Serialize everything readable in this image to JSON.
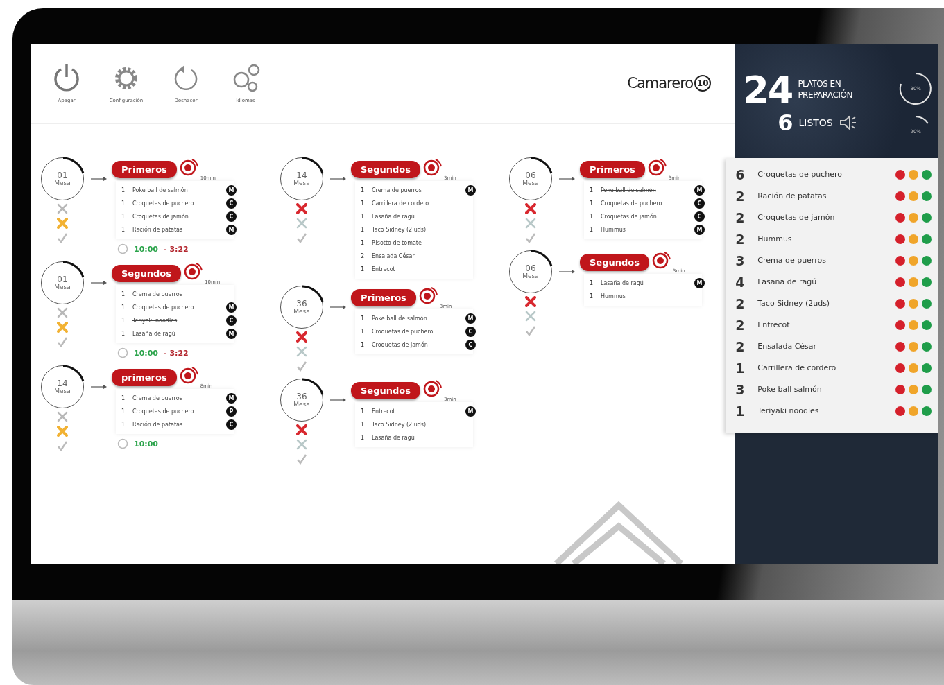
{
  "toolbar": {
    "buttons": [
      {
        "kind": "power",
        "label": "Apagar"
      },
      {
        "kind": "gear",
        "label": "Configuración"
      },
      {
        "kind": "undo",
        "label": "Deshacer"
      },
      {
        "kind": "language",
        "label": "Idiomas"
      }
    ],
    "logo": "Camarero",
    "logo_badge": "10"
  },
  "columns": [
    [
      {
        "table": "01",
        "table_label": "Mesa",
        "cancelled": false,
        "delayed": true,
        "course": "Primeros",
        "eta": "10min",
        "times": {
          "start": "10:00",
          "elapsed": "- 3:22"
        },
        "items": [
          {
            "qty": "1",
            "name": "Poke ball de salmón",
            "badge": "M",
            "done": false
          },
          {
            "qty": "1",
            "name": "Croquetas de puchero",
            "badge": "C",
            "done": false
          },
          {
            "qty": "1",
            "name": "Croquetas de jamón",
            "badge": "C",
            "done": false
          },
          {
            "qty": "1",
            "name": "Ración de patatas",
            "badge": "M",
            "done": false
          }
        ]
      },
      {
        "table": "01",
        "table_label": "Mesa",
        "cancelled": false,
        "delayed": true,
        "course": "Segundos",
        "eta": "10min",
        "times": {
          "start": "10:00",
          "elapsed": "- 3:22"
        },
        "items": [
          {
            "qty": "1",
            "name": "Crema de puerros",
            "done": false
          },
          {
            "qty": "1",
            "name": "Croquetas de puchero",
            "badge": "M",
            "done": false
          },
          {
            "qty": "1",
            "name": "Teriyaki noodles",
            "badge": "C",
            "done": true
          },
          {
            "qty": "1",
            "name": "Lasaña de ragú",
            "badge": "M",
            "done": false
          }
        ]
      },
      {
        "table": "14",
        "table_label": "Mesa",
        "cancelled": false,
        "delayed": true,
        "course": "primeros",
        "eta": "8min",
        "times": {
          "start": "10:00"
        },
        "items": [
          {
            "qty": "1",
            "name": "Crema de puerros",
            "badge": "M",
            "done": false
          },
          {
            "qty": "1",
            "name": "Croquetas de puchero",
            "badge": "P",
            "done": false
          },
          {
            "qty": "1",
            "name": "Ración de patatas",
            "badge": "C",
            "done": false
          }
        ]
      }
    ],
    [
      {
        "table": "14",
        "table_label": "Mesa",
        "cancelled": true,
        "delayed": false,
        "course": "Segundos",
        "eta": "3min",
        "items": [
          {
            "qty": "1",
            "name": "Crema de puerros",
            "badge": "M",
            "done": false
          },
          {
            "qty": "1",
            "name": "Carrillera de cordero",
            "done": false
          },
          {
            "qty": "1",
            "name": "Lasaña de ragú",
            "done": false
          },
          {
            "qty": "1",
            "name": "Taco Sidney (2 uds)",
            "done": false
          },
          {
            "qty": "1",
            "name": "Risotto de tomate",
            "done": false
          },
          {
            "qty": "2",
            "name": "Ensalada César",
            "done": false
          },
          {
            "qty": "1",
            "name": "Entrecot",
            "done": false
          }
        ]
      },
      {
        "table": "36",
        "table_label": "Mesa",
        "cancelled": true,
        "delayed": false,
        "course": "Primeros",
        "eta": "3min",
        "items": [
          {
            "qty": "1",
            "name": "Poke ball de salmón",
            "badge": "M",
            "done": false
          },
          {
            "qty": "1",
            "name": "Croquetas de puchero",
            "badge": "C",
            "done": false
          },
          {
            "qty": "1",
            "name": "Croquetas de jamón",
            "badge": "C",
            "done": false
          }
        ]
      },
      {
        "table": "36",
        "table_label": "Mesa",
        "cancelled": true,
        "delayed": false,
        "course": "Segundos",
        "eta": "3min",
        "items": [
          {
            "qty": "1",
            "name": "Entrecot",
            "badge": "M",
            "done": false
          },
          {
            "qty": "1",
            "name": "Taco Sidney (2 uds)",
            "done": false
          },
          {
            "qty": "1",
            "name": "Lasaña de ragú",
            "done": false
          }
        ]
      }
    ],
    [
      {
        "table": "06",
        "table_label": "Mesa",
        "cancelled": true,
        "delayed": false,
        "course": "Primeros",
        "eta": "3min",
        "items": [
          {
            "qty": "1",
            "name": "Poke ball de salmón",
            "badge": "M",
            "done": true
          },
          {
            "qty": "1",
            "name": "Croquetas de puchero",
            "badge": "C",
            "done": false
          },
          {
            "qty": "1",
            "name": "Croquetas de jamón",
            "badge": "C",
            "done": false
          },
          {
            "qty": "1",
            "name": "Hummus",
            "badge": "M",
            "done": false
          }
        ]
      },
      {
        "table": "06",
        "table_label": "Mesa",
        "cancelled": true,
        "delayed": false,
        "course": "Segundos",
        "eta": "3min",
        "items": [
          {
            "qty": "1",
            "name": "Lasaña de ragú",
            "badge": "M",
            "done": false
          },
          {
            "qty": "1",
            "name": "Hummus",
            "done": false
          }
        ]
      }
    ]
  ],
  "summary": {
    "in_progress": "24",
    "in_progress_label": "PLATOS EN PREPARACIÓN",
    "ready": "6",
    "ready_label": "LISTOS",
    "gauges": [
      {
        "reading": "80%"
      },
      {
        "reading": "20%"
      }
    ],
    "dishes": [
      {
        "qty": "6",
        "name": "Croquetas de puchero"
      },
      {
        "qty": "2",
        "name": "Ración de patatas"
      },
      {
        "qty": "2",
        "name": "Croquetas de jamón"
      },
      {
        "qty": "2",
        "name": "Hummus"
      },
      {
        "qty": "3",
        "name": "Crema de puerros"
      },
      {
        "qty": "4",
        "name": "Lasaña de ragú"
      },
      {
        "qty": "2",
        "name": "Taco Sidney (2uds)"
      },
      {
        "qty": "2",
        "name": "Entrecot"
      },
      {
        "qty": "2",
        "name": "Ensalada César"
      },
      {
        "qty": "1",
        "name": "Carrillera de cordero"
      },
      {
        "qty": "3",
        "name": "Poke ball salmón"
      },
      {
        "qty": "1",
        "name": "Teriyaki noodles"
      }
    ]
  }
}
